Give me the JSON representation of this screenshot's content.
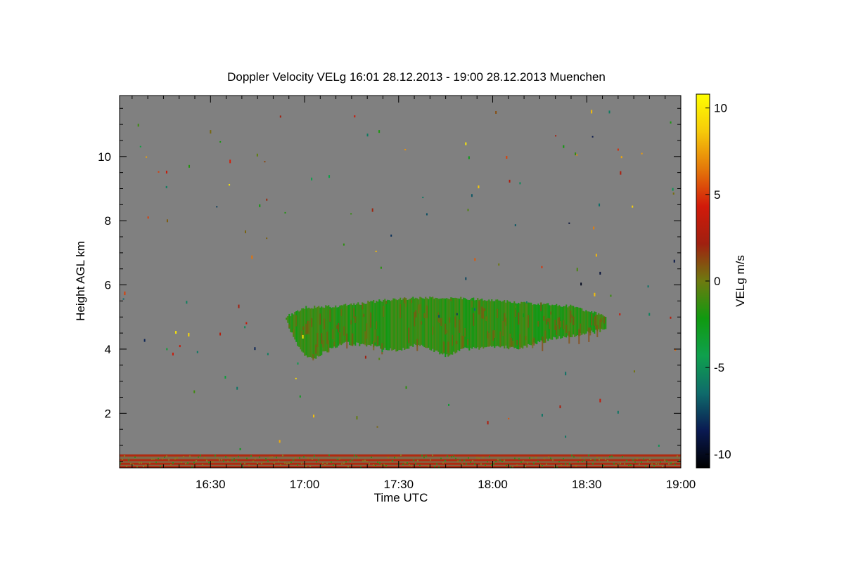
{
  "chart_data": {
    "type": "heatmap",
    "title": "Doppler Velocity VELg   16:01 28.12.2013 - 19:00 28.12.2013 Muenchen",
    "xlabel": "Time UTC",
    "ylabel": "Height AGL km",
    "colorbar_label": "VELg m/s",
    "xlim": [
      "16:01",
      "19:00"
    ],
    "ylim": [
      0.3,
      11.9
    ],
    "x_ticks": [
      "16:30",
      "17:00",
      "17:30",
      "18:00",
      "18:30",
      "19:00"
    ],
    "y_ticks": [
      "2",
      "4",
      "6",
      "8",
      "10"
    ],
    "colorbar_range": [
      -10.8,
      10.8
    ],
    "colorbar_ticks": [
      "10",
      "5",
      "0",
      "-5",
      "-10"
    ],
    "background_color": "#808080",
    "colormap": [
      "#000000",
      "#0a1a52",
      "#0f6b6b",
      "#0fa04d",
      "#109a10",
      "#6e7a10",
      "#a02010",
      "#d21a0a",
      "#e4780a",
      "#f6ca0a",
      "#ffff00"
    ],
    "features": {
      "cloud_layer": {
        "time_start": "16:54",
        "time_end": "18:36",
        "base_km": [
          [
            16.9,
            4.9
          ],
          [
            16.95,
            4.2
          ],
          [
            17.0,
            3.8
          ],
          [
            17.05,
            3.7
          ],
          [
            17.1,
            3.9
          ],
          [
            17.2,
            4.2
          ],
          [
            17.35,
            4.1
          ],
          [
            17.5,
            3.95
          ],
          [
            17.6,
            4.15
          ],
          [
            17.75,
            3.8
          ],
          [
            17.85,
            4.0
          ],
          [
            18.0,
            4.05
          ],
          [
            18.15,
            4.05
          ],
          [
            18.3,
            4.3
          ],
          [
            18.45,
            4.45
          ],
          [
            18.6,
            4.6
          ]
        ],
        "top_km": [
          [
            16.9,
            5.0
          ],
          [
            17.0,
            5.3
          ],
          [
            17.2,
            5.35
          ],
          [
            17.45,
            5.55
          ],
          [
            17.7,
            5.62
          ],
          [
            17.95,
            5.55
          ],
          [
            18.15,
            5.45
          ],
          [
            18.4,
            5.35
          ],
          [
            18.6,
            5.05
          ]
        ],
        "typical_velocity_ms": -1.5
      },
      "near_surface_noise_km": [
        0.3,
        0.72
      ]
    }
  }
}
